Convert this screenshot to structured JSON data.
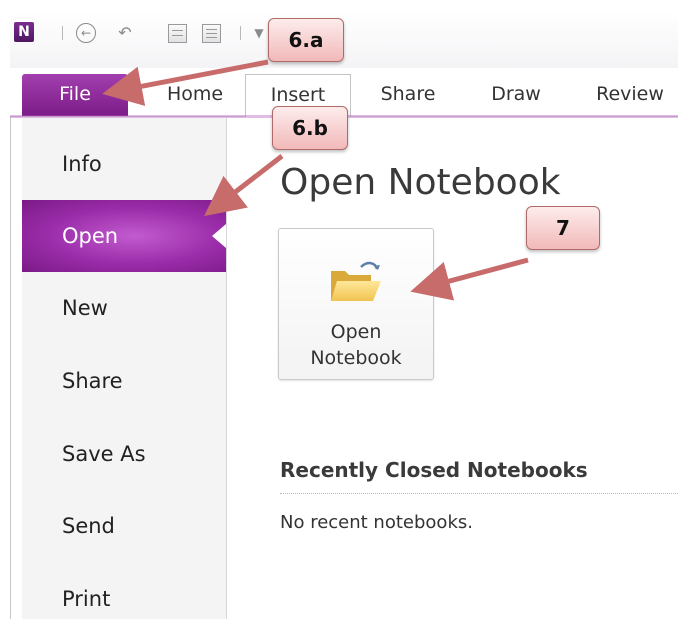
{
  "app": {
    "logo_letter": "N"
  },
  "ribbon": {
    "tabs": [
      "File",
      "Home",
      "Insert",
      "Share",
      "Draw",
      "Review"
    ]
  },
  "backstage": {
    "nav": [
      "Info",
      "Open",
      "New",
      "Share",
      "Save As",
      "Send",
      "Print"
    ],
    "active": "Open"
  },
  "main": {
    "title": "Open Notebook",
    "open_button": {
      "line1": "Open",
      "line2": "Notebook",
      "icon": "folder-open-icon"
    },
    "recent_heading": "Recently Closed Notebooks",
    "recent_empty": "No recent notebooks."
  },
  "callouts": {
    "a": "6.a",
    "b": "6.b",
    "c": "7"
  },
  "colors": {
    "accent": "#8e2a9b",
    "callout_fill": "#f5c6c6",
    "arrow": "#c86b6b"
  }
}
